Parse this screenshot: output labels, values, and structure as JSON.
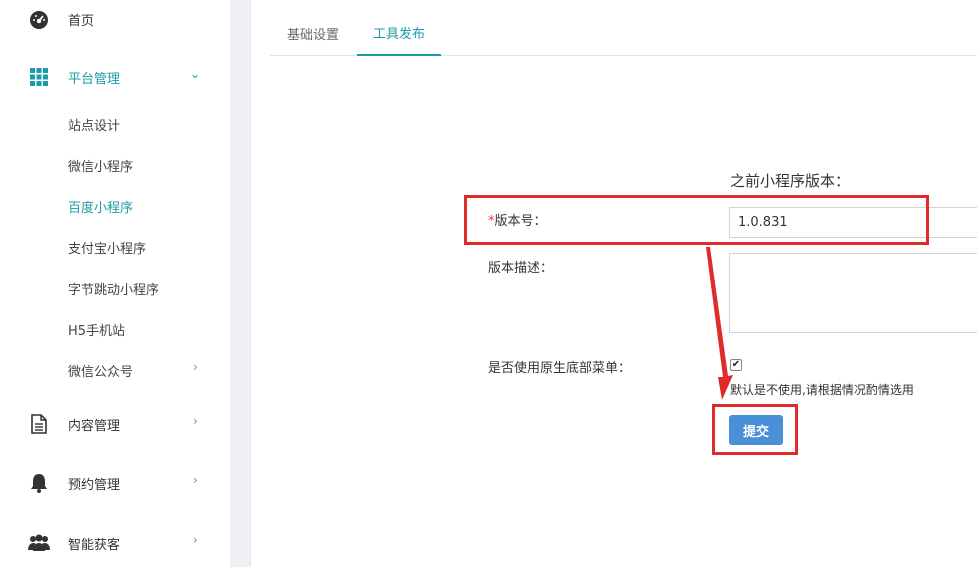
{
  "sidebar": {
    "items": [
      {
        "label": "首页",
        "icon": "dashboard-icon"
      },
      {
        "label": "平台管理",
        "icon": "grid-icon",
        "expanded": true
      },
      {
        "label": "内容管理",
        "icon": "document-icon"
      },
      {
        "label": "预约管理",
        "icon": "bell-icon"
      },
      {
        "label": "智能获客",
        "icon": "users-icon"
      }
    ],
    "sub_items": [
      {
        "label": "站点设计"
      },
      {
        "label": "微信小程序"
      },
      {
        "label": "百度小程序",
        "active": true
      },
      {
        "label": "支付宝小程序"
      },
      {
        "label": "字节跳动小程序"
      },
      {
        "label": "H5手机站"
      },
      {
        "label": "微信公众号"
      }
    ],
    "arrow_down": "⌄",
    "arrow_right": "›"
  },
  "tabs": [
    {
      "label": "基础设置"
    },
    {
      "label": "工具发布",
      "active": true
    }
  ],
  "form": {
    "prev_version_label": "之前小程序版本：",
    "required_mark": "*",
    "version_label": "版本号：",
    "version_value": "1.0.831",
    "desc_label": "版本描述：",
    "native_menu_label": "是否使用原生底部菜单：",
    "native_menu_checked": true,
    "native_menu_hint": "默认是不使用,请根据情况酌情选用",
    "submit_label": "提交"
  },
  "colors": {
    "accent": "#1a9da9",
    "annotation": "#e02b2b",
    "button": "#4a90d9"
  }
}
